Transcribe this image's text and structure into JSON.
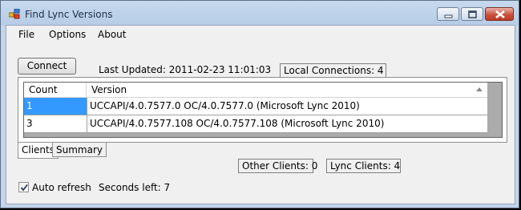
{
  "window": {
    "title": "Find Lync Versions",
    "icon": "app-icon",
    "controls": [
      "minimize-icon",
      "maximize-icon",
      "close-icon"
    ]
  },
  "menu": [
    "File",
    "Options",
    "About"
  ],
  "toolbar": {
    "connect_label": "Connect",
    "last_updated": "Last Updated: 2011-02-23 11:01:03",
    "local_connections": "Local Connections: 4"
  },
  "grid": {
    "columns": [
      "Count",
      "Version"
    ],
    "sort_icon": "sort-ascending-icon",
    "rows": [
      {
        "count": "1",
        "version": "UCCAPI/4.0.7577.0 OC/4.0.7577.0 (Microsoft Lync 2010)"
      },
      {
        "count": "3",
        "version": "UCCAPI/4.0.7577.108 OC/4.0.7577.108 (Microsoft Lync 2010)"
      }
    ]
  },
  "tabs": [
    "Clients",
    "Summary"
  ],
  "status": {
    "other_clients": "Other Clients: 0",
    "lync_clients": "Lync Clients: 4"
  },
  "footer": {
    "auto_refresh_label": "Auto refresh",
    "auto_refresh_checked": true,
    "seconds_left": "Seconds left: 7"
  },
  "colors": {
    "selection": "#3399ff",
    "title_bar": "#c6d9ee",
    "close_button": "#c9523f"
  }
}
